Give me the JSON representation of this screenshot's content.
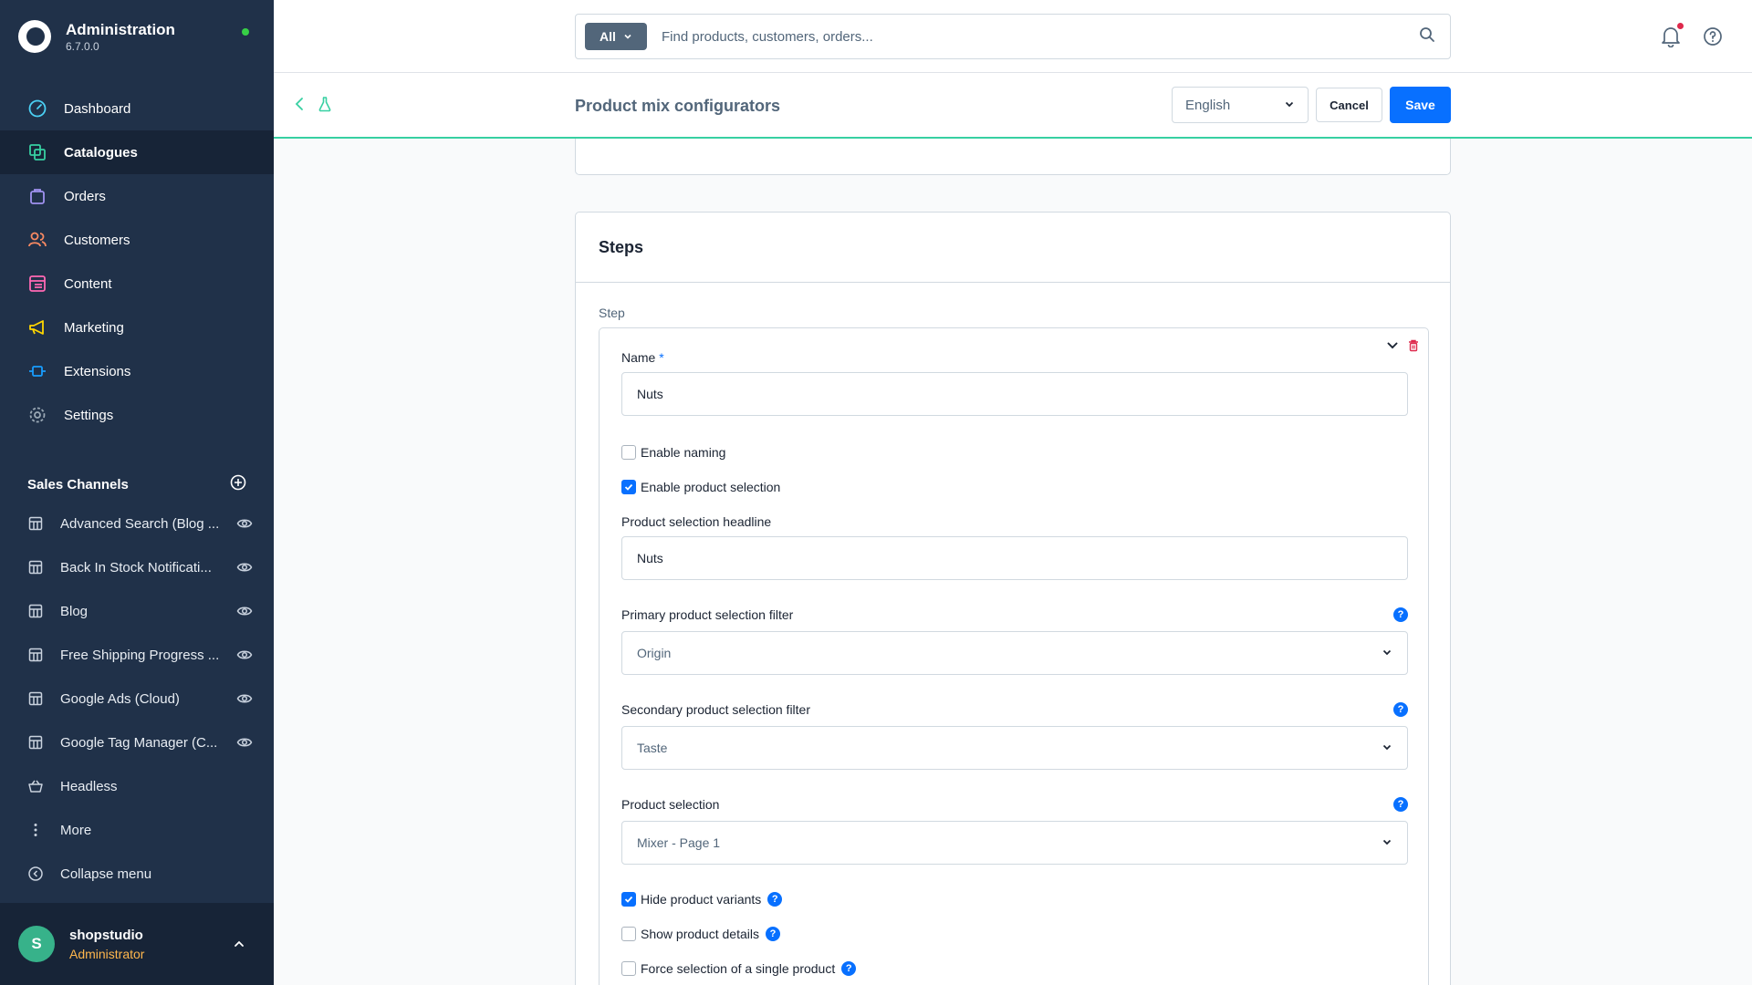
{
  "brand": {
    "title": "Administration",
    "version": "6.7.0.0"
  },
  "nav": [
    {
      "label": "Dashboard",
      "icon": "gauge-icon",
      "color": "#4bd1f5"
    },
    {
      "label": "Catalogues",
      "icon": "catalogue-icon",
      "color": "#37d0a2"
    },
    {
      "label": "Orders",
      "icon": "bag-icon",
      "color": "#a092f0"
    },
    {
      "label": "Customers",
      "icon": "users-icon",
      "color": "#f88962"
    },
    {
      "label": "Content",
      "icon": "content-icon",
      "color": "#ff68b4"
    },
    {
      "label": "Marketing",
      "icon": "megaphone-icon",
      "color": "#ffd700"
    },
    {
      "label": "Extensions",
      "icon": "plug-icon",
      "color": "#189eff"
    },
    {
      "label": "Settings",
      "icon": "gear-icon",
      "color": "#9aa8b5"
    }
  ],
  "sales_channels": {
    "header": "Sales Channels",
    "items": [
      {
        "label": "Advanced Search (Blog ..."
      },
      {
        "label": "Back In Stock Notificati..."
      },
      {
        "label": "Blog"
      },
      {
        "label": "Free Shipping Progress ..."
      },
      {
        "label": "Google Ads (Cloud)"
      },
      {
        "label": "Google Tag Manager (C..."
      },
      {
        "label": "Headless"
      }
    ],
    "more": "More",
    "collapse": "Collapse menu"
  },
  "user": {
    "initial": "S",
    "name": "shopstudio",
    "role": "Administrator"
  },
  "search": {
    "type": "All",
    "placeholder": "Find products, customers, orders..."
  },
  "smartbar": {
    "title": "Product mix configurators",
    "language": "English",
    "cancel": "Cancel",
    "save": "Save"
  },
  "steps_card": {
    "title": "Steps",
    "step_label": "Step",
    "name_label": "Name",
    "required_marker": "*",
    "name_value": "Nuts",
    "enable_naming": {
      "label": "Enable naming",
      "checked": false
    },
    "enable_product_selection": {
      "label": "Enable product selection",
      "checked": true
    },
    "headline_label": "Product selection headline",
    "headline_value": "Nuts",
    "primary_filter_label": "Primary product selection filter",
    "primary_filter_value": "Origin",
    "secondary_filter_label": "Secondary product selection filter",
    "secondary_filter_value": "Taste",
    "product_selection_label": "Product selection",
    "product_selection_value": "Mixer - Page 1",
    "help_glyph": "?",
    "hide_variants": {
      "label": "Hide product variants",
      "checked": true
    },
    "show_details": {
      "label": "Show product details",
      "checked": false
    },
    "force_single": {
      "label": "Force selection of a single product",
      "checked": false
    }
  },
  "colors": {
    "sidebar": "#203149",
    "accent": "#0870ff",
    "success": "#37d0a2",
    "notification": "#de294c"
  }
}
